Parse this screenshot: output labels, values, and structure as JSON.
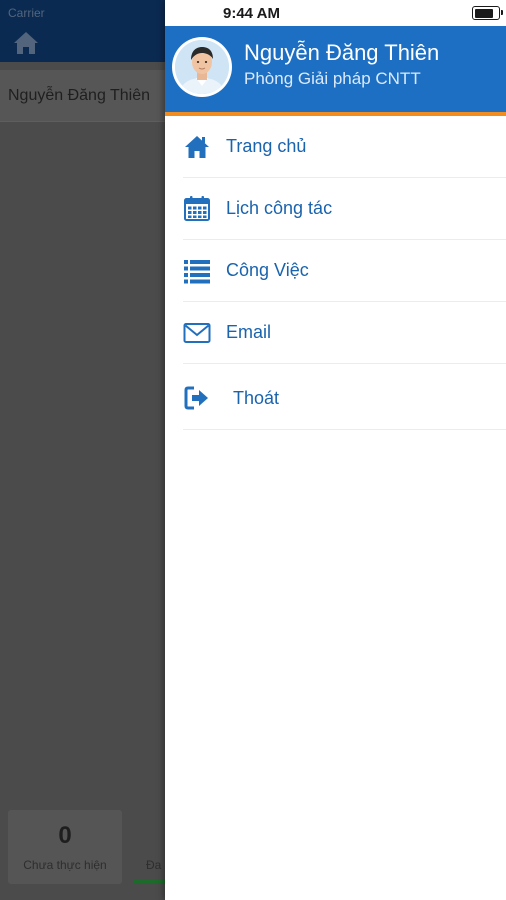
{
  "background_app": {
    "carrier": "Carrier",
    "user_name": "Nguyễn Đăng Thiên",
    "stats": [
      {
        "count": "0",
        "label": "Chưa thực hiện"
      },
      {
        "label": "Đa"
      }
    ]
  },
  "status_bar": {
    "time": "9:44 AM",
    "battery_level": 0.85
  },
  "profile": {
    "name": "Nguyễn Đăng Thiên",
    "department": "Phòng Giải pháp CNTT"
  },
  "menu": {
    "items": [
      {
        "label": "Trang chủ",
        "icon": "home-icon"
      },
      {
        "label": "Lịch công tác",
        "icon": "calendar-icon"
      },
      {
        "label": "Công Việc",
        "icon": "list-icon"
      },
      {
        "label": "Email",
        "icon": "envelope-icon"
      },
      {
        "label": "Thoát",
        "icon": "sign-out-icon"
      }
    ]
  },
  "colors": {
    "header_blue": "#1d6fc3",
    "accent_orange": "#f08c20",
    "menu_text_blue": "#1a63ad",
    "icon_blue": "#2270bd"
  }
}
